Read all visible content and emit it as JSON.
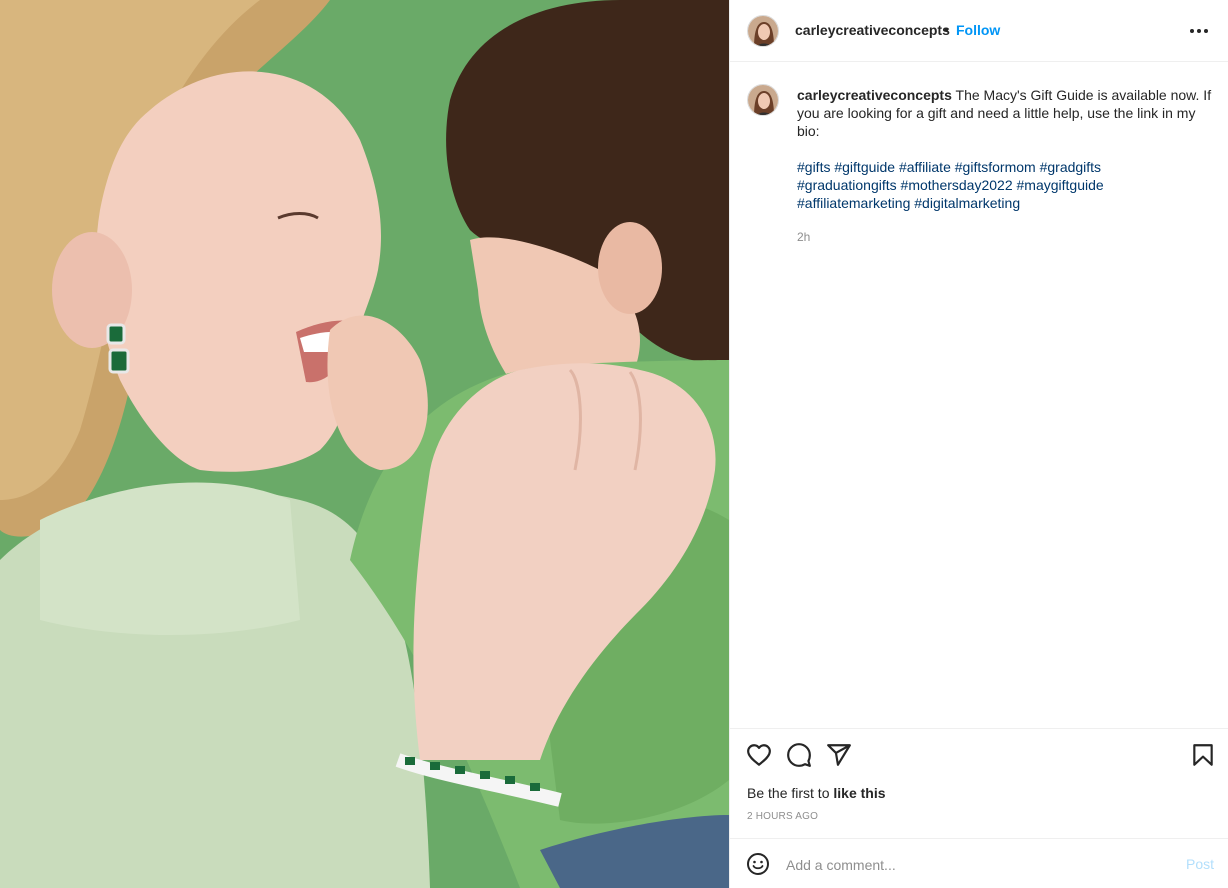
{
  "post": {
    "image": {
      "icon": "photo-mother-and-child"
    },
    "author": {
      "username": "carleycreativeconcepts",
      "separator": "•",
      "follow_label": "Follow"
    },
    "caption": {
      "username": "carleycreativeconcepts",
      "text": "The Macy's Gift Guide is available now. If you are looking for a gift and need a little help, use the link in my bio:",
      "hashtags": [
        "#gifts",
        "#giftguide",
        "#affiliate",
        "#giftsformom",
        "#gradgifts",
        "#graduationgifts",
        "#mothersday2022",
        "#maygiftguide",
        "#affiliatemarketing",
        "#digitalmarketing"
      ],
      "age": "2h"
    },
    "likes": {
      "prefix": "Be the first to",
      "link": "like this"
    },
    "timestamp": "2 HOURS AGO",
    "comment": {
      "placeholder": "Add a comment...",
      "post_label": "Post"
    },
    "icons": {
      "more": "more-options-icon",
      "like": "heart-icon",
      "comment": "comment-icon",
      "share": "share-icon",
      "save": "bookmark-icon",
      "emoji": "emoji-icon"
    }
  }
}
